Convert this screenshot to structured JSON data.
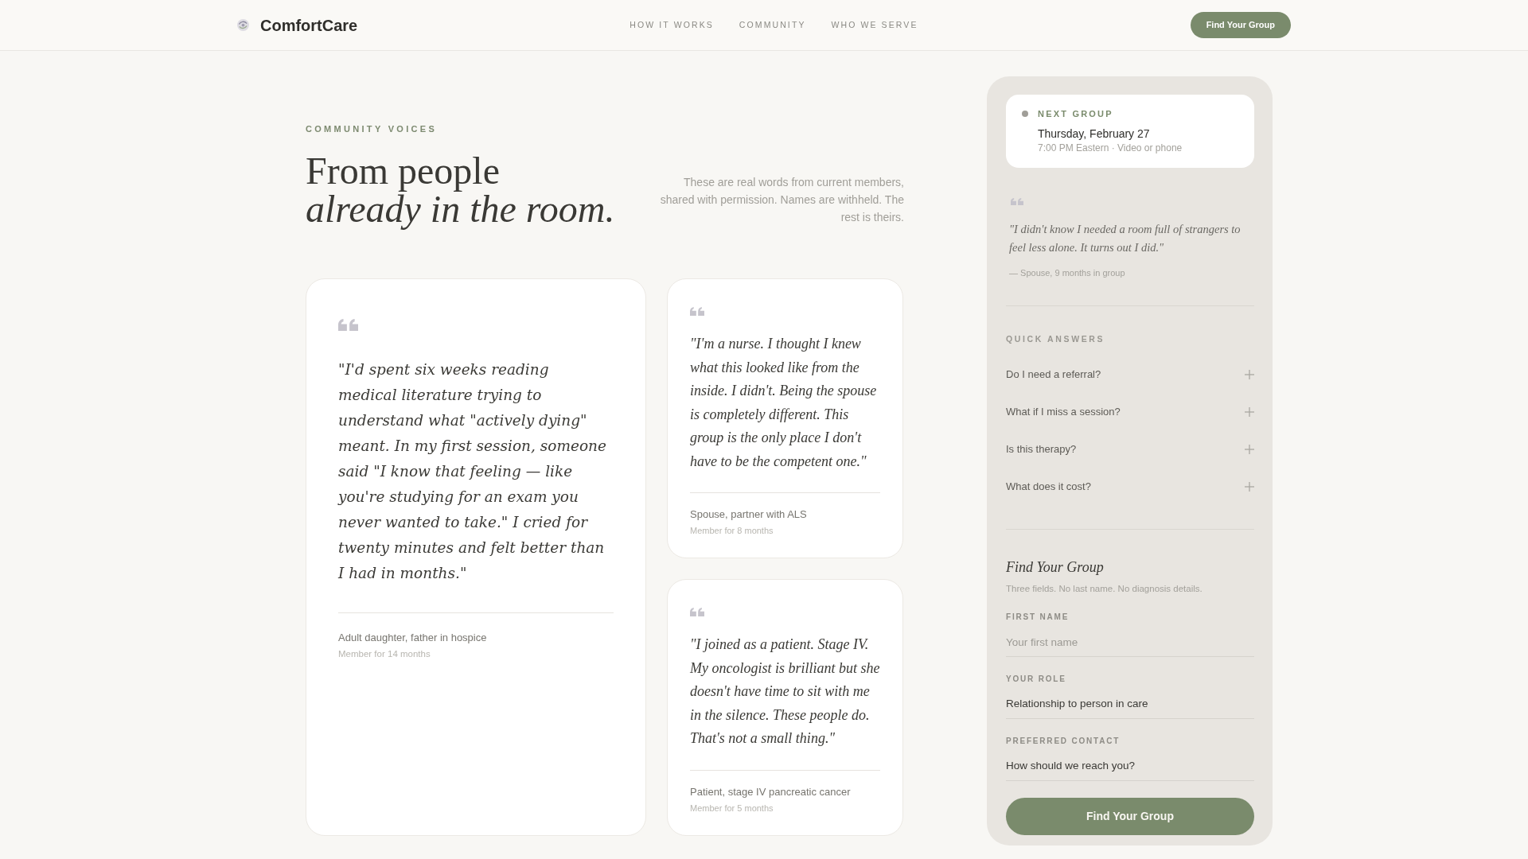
{
  "header": {
    "brand": "ComfortCare",
    "nav": [
      {
        "label": "HOW IT WORKS"
      },
      {
        "label": "COMMUNITY"
      },
      {
        "label": "WHO WE SERVE"
      }
    ],
    "cta": "Find Your Group"
  },
  "intro": {
    "eyebrow": "COMMUNITY VOICES",
    "title": "From people",
    "title_emphasis": "already in the room.",
    "description": "These are real words from current members, shared with permission. Names are withheld. The rest is theirs."
  },
  "testimonials": [
    {
      "kind": "featured",
      "quote": "\"I'd spent six weeks reading medical literature trying to understand what \"actively dying\" meant. In my first session, someone said \"I know that feeling — like you're studying for an exam you never wanted to take.\" I cried for twenty minutes and felt better than I had in months.\"",
      "author": "Adult daughter, father in hospice",
      "tenure": "Member for 14 months"
    },
    {
      "kind": "standard",
      "quote": "\"I'm a nurse. I thought I knew what this looked like from the inside. I didn't. Being the spouse is completely different. This group is the only place I don't have to be the competent one.\"",
      "author": "Spouse, partner with ALS",
      "tenure": "Member for 8 months"
    },
    {
      "kind": "standard",
      "quote": "\"I joined as a patient. Stage IV. My oncologist is brilliant but she doesn't have time to sit with me in the silence. These people do. That's not a small thing.\"",
      "author": "Patient, stage IV pancreatic cancer",
      "tenure": "Member for 5 months"
    }
  ],
  "sidebar": {
    "next_group": {
      "label": "NEXT GROUP",
      "date": "Thursday, February 27",
      "details": "7:00 PM Eastern · Video or phone"
    },
    "quote": {
      "text": "\"I didn't know I needed a room full of strangers to feel less alone. It turns out I did.\"",
      "attribution": "— Spouse, 9 months in group"
    },
    "quick_answers": {
      "title": "QUICK ANSWERS",
      "items": [
        {
          "question": "Do I need a referral?",
          "expanded": false
        },
        {
          "question": "What if I miss a session?",
          "expanded": false
        },
        {
          "question": "Is this therapy?",
          "expanded": false
        },
        {
          "question": "What does it cost?",
          "expanded": false
        }
      ]
    },
    "form": {
      "title": "Find Your Group",
      "subtitle": "Three fields. No last name. No diagnosis details.",
      "fields": [
        {
          "kind": "text",
          "label": "FIRST NAME",
          "placeholder": "Your first name"
        },
        {
          "kind": "select",
          "label": "YOUR ROLE",
          "value": "Relationship to person in care"
        },
        {
          "kind": "select",
          "label": "PREFERRED CONTACT",
          "value": "How should we reach you?"
        }
      ],
      "submit": "Find Your Group"
    }
  }
}
